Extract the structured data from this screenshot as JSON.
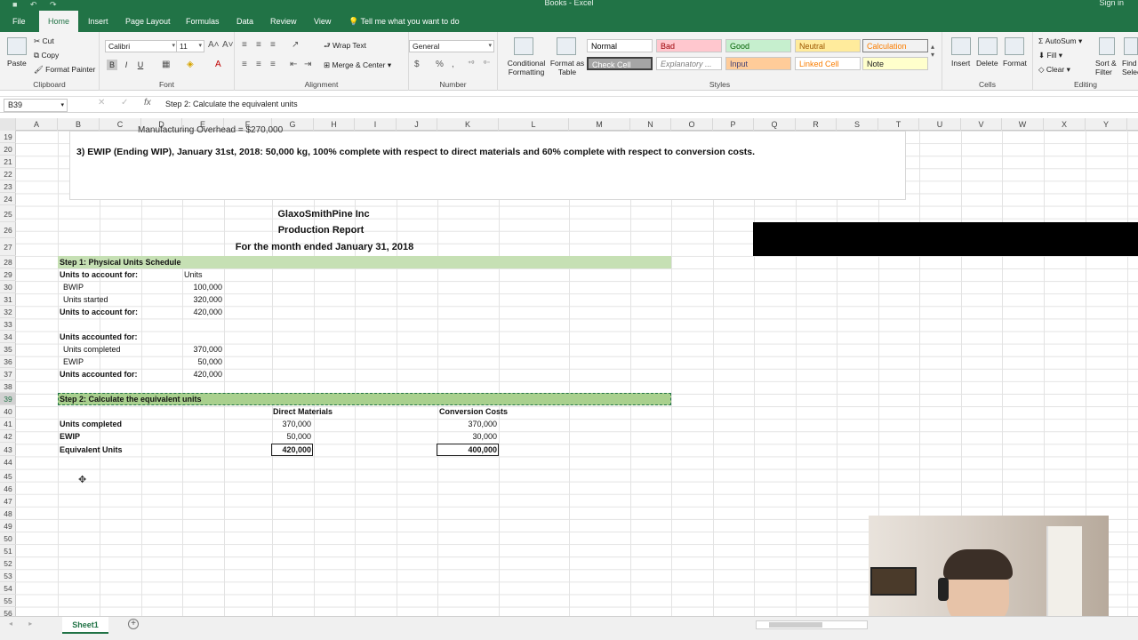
{
  "title_bar": {
    "title": "Books - Excel",
    "signin": "Sign in"
  },
  "menu": {
    "tabs": [
      {
        "label": "File"
      },
      {
        "label": "Home"
      },
      {
        "label": "Insert"
      },
      {
        "label": "Page Layout"
      },
      {
        "label": "Formulas"
      },
      {
        "label": "Data"
      },
      {
        "label": "Review"
      },
      {
        "label": "View"
      }
    ],
    "tell_me": "Tell me what you want to do"
  },
  "ribbon": {
    "clipboard": {
      "paste": "Paste",
      "cut": "Cut",
      "copy": "Copy",
      "format_painter": "Format Painter",
      "label": "Clipboard"
    },
    "font": {
      "name": "Calibri",
      "size": "11",
      "label": "Font",
      "bold": "B",
      "italic": "I",
      "underline": "U"
    },
    "alignment": {
      "wrap": "Wrap Text",
      "merge": "Merge & Center",
      "label": "Alignment"
    },
    "number": {
      "format": "General",
      "currency": "$",
      "percent": "%",
      "comma": ",",
      "label": "Number"
    },
    "styles": {
      "conditional": "Conditional Formatting",
      "format_table": "Format as Table",
      "cells": [
        "Normal",
        "Bad",
        "Good",
        "Neutral",
        "Calculation",
        "Check Cell",
        "Explanatory ...",
        "Input",
        "Linked Cell",
        "Note"
      ],
      "label": "Styles"
    },
    "cells": {
      "insert": "Insert",
      "delete": "Delete",
      "format": "Format",
      "label": "Cells"
    },
    "editing": {
      "autosum": "AutoSum",
      "fill": "Fill",
      "clear": "Clear",
      "sort": "Sort & Filter",
      "find": "Find & Select",
      "label": "Editing"
    }
  },
  "formula_bar": {
    "name_box": "B39",
    "fx": "fx",
    "content": "Step 2: Calculate the equivalent units"
  },
  "columns": [
    "A",
    "B",
    "C",
    "D",
    "E",
    "F",
    "G",
    "H",
    "I",
    "J",
    "K",
    "L",
    "M",
    "N",
    "O",
    "P",
    "Q",
    "R",
    "S",
    "T",
    "U",
    "V",
    "W",
    "X",
    "Y"
  ],
  "rows": [
    "19",
    "20",
    "21",
    "22",
    "23",
    "24",
    "25",
    "26",
    "27",
    "28",
    "29",
    "30",
    "31",
    "32",
    "33",
    "34",
    "35",
    "36",
    "37",
    "38",
    "39",
    "40",
    "41",
    "42",
    "43",
    "44",
    "45",
    "46",
    "47",
    "48",
    "49",
    "50",
    "51",
    "52",
    "53",
    "54",
    "55",
    "56"
  ],
  "textbox": {
    "overflow_line": "Manufacturing Overhead = $270,000",
    "line3": "3)  EWIP (Ending WIP), January 31st, 2018: 50,000 kg, 100% complete with respect to direct materials and 60% complete with respect to conversion costs."
  },
  "report": {
    "company": "GlaxoSmithPine Inc",
    "title": "Production Report",
    "period": "For the month ended January 31, 2018"
  },
  "step1": {
    "header": "Step 1: Physical Units Schedule",
    "to_account_label": "Units to account for:",
    "units_col": "Units",
    "bwip_label": "BWIP",
    "bwip_value": "100,000",
    "started_label": "Units started",
    "started_value": "320,000",
    "to_account_total_label": "Units to account for:",
    "to_account_total": "420,000",
    "accounted_label": "Units accounted for:",
    "completed_label": "Units completed",
    "completed_value": "370,000",
    "ewip_label": "EWIP",
    "ewip_value": "50,000",
    "accounted_total_label": "Units accounted for:",
    "accounted_total": "420,000"
  },
  "step2": {
    "header": "Step 2: Calculate the equivalent units",
    "dm_header": "Direct Materials",
    "cc_header": "Conversion Costs",
    "completed_label": "Units completed",
    "dm_completed": "370,000",
    "cc_completed": "370,000",
    "ewip_label": "EWIP",
    "dm_ewip": "50,000",
    "cc_ewip": "30,000",
    "eu_label": "Equivalent Units",
    "dm_eu": "420,000",
    "cc_eu": "400,000"
  },
  "sheet_tabs": {
    "active": "Sheet1",
    "add": "+"
  },
  "colors": {
    "excel_green": "#217346",
    "step_band": "#c6e0b4"
  }
}
